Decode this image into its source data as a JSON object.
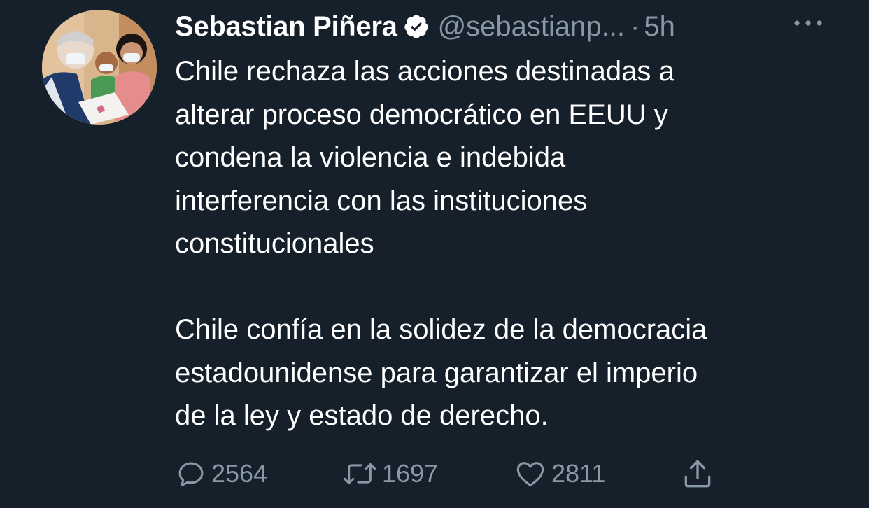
{
  "tweet": {
    "author_name": "Sebastian Piñera",
    "handle": "@sebastianp...",
    "separator": "·",
    "time": "5h",
    "paragraphs": [
      {
        "lines": [
          "Chile rechaza las acciones destinadas a",
          "alterar proceso democrático en EEUU y",
          "condena la violencia e indebida",
          "interferencia con las instituciones",
          "constitucionales"
        ]
      },
      {
        "lines": [
          "Chile confía en la solidez de la democracia",
          "estadounidense para garantizar el imperio",
          "de la ley y estado de derecho."
        ]
      }
    ],
    "actions": {
      "reply_count": "2564",
      "retweet_count": "1697",
      "like_count": "2811"
    }
  },
  "icons": {
    "avatar": "profile-photo",
    "verified": "verified-badge-icon",
    "more": "more-options-icon",
    "reply": "reply-icon",
    "retweet": "retweet-icon",
    "like": "heart-icon",
    "share": "share-icon"
  },
  "colors": {
    "background": "#15202b",
    "text": "#ffffff",
    "muted": "#8899a6"
  }
}
